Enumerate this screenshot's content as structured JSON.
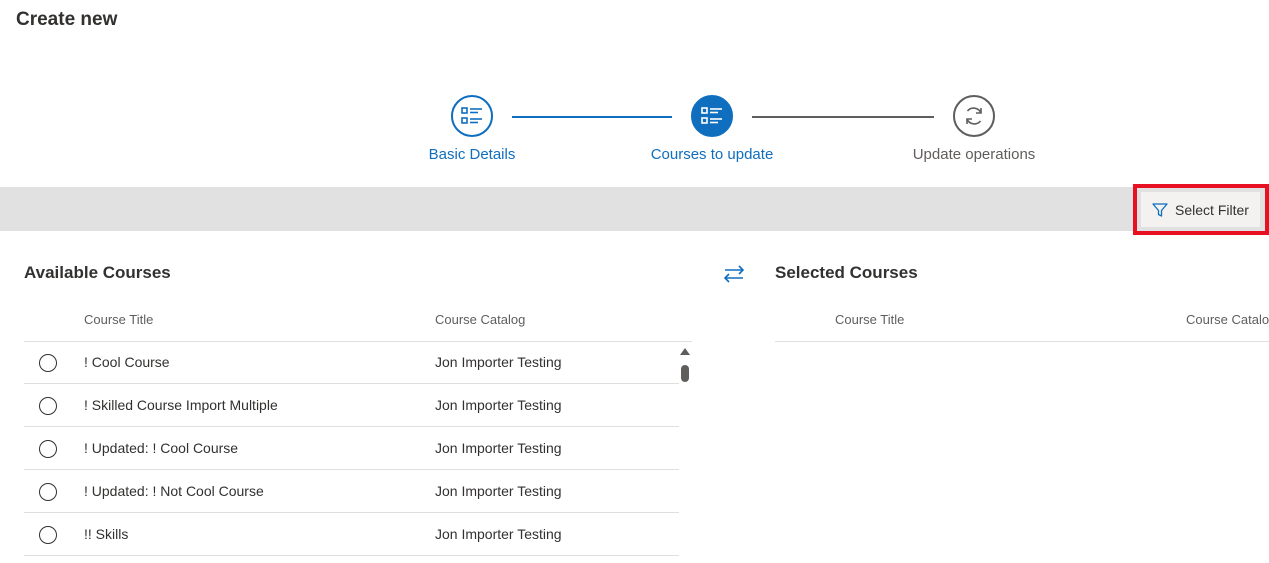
{
  "page": {
    "title": "Create new"
  },
  "stepper": {
    "steps": [
      {
        "label": "Basic Details",
        "state": "done",
        "icon": "list-icon"
      },
      {
        "label": "Courses to update",
        "state": "active",
        "icon": "list-icon"
      },
      {
        "label": "Update operations",
        "state": "pending",
        "icon": "sync-icon"
      }
    ]
  },
  "toolbar": {
    "filter_label": "Select Filter",
    "filter_icon": "filter-icon"
  },
  "available": {
    "title": "Available Courses",
    "columns": [
      "Course Title",
      "Course Catalog"
    ],
    "rows": [
      {
        "title": "! Cool Course",
        "catalog": "Jon Importer Testing"
      },
      {
        "title": "! Skilled Course Import Multiple",
        "catalog": "Jon Importer Testing"
      },
      {
        "title": "! Updated: ! Cool Course",
        "catalog": "Jon Importer Testing"
      },
      {
        "title": "! Updated: ! Not Cool Course",
        "catalog": "Jon Importer Testing"
      },
      {
        "title": "!! Skills",
        "catalog": "Jon Importer Testing"
      }
    ]
  },
  "selected": {
    "title": "Selected Courses",
    "columns": [
      "Course Title",
      "Course Catalog"
    ]
  },
  "colors": {
    "accent": "#106ebe",
    "highlight": "#e81123",
    "band": "#e1e1e1"
  }
}
